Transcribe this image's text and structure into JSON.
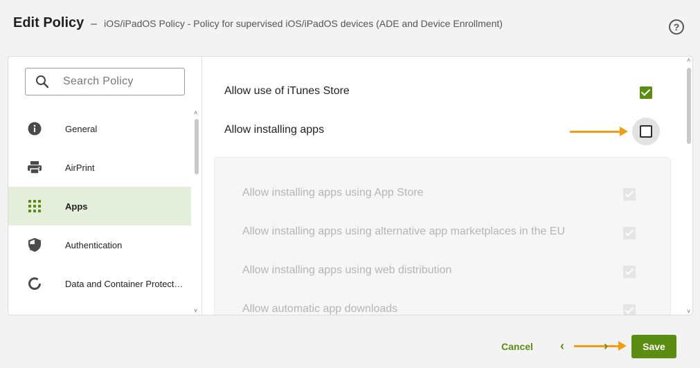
{
  "header": {
    "title": "Edit Policy",
    "separator": "–",
    "subtitle": "iOS/iPadOS Policy - Policy for supervised iOS/iPadOS devices (ADE and Device Enrollment)",
    "help_icon": "question-circle-icon",
    "help_glyph": "?"
  },
  "sidebar": {
    "search": {
      "placeholder": "Search Policy",
      "value": ""
    },
    "items": [
      {
        "label": "General",
        "icon": "info-icon",
        "active": false
      },
      {
        "label": "AirPrint",
        "icon": "printer-icon",
        "active": false
      },
      {
        "label": "Apps",
        "icon": "apps-grid-icon",
        "active": true
      },
      {
        "label": "Authentication",
        "icon": "shield-icon",
        "active": false
      },
      {
        "label": "Data and Container Protection",
        "icon": "ring-icon",
        "active": false
      }
    ]
  },
  "content": {
    "settings": [
      {
        "label": "Allow use of iTunes Store",
        "checked": true
      },
      {
        "label": "Allow installing apps",
        "checked": false
      }
    ],
    "sub_settings": [
      {
        "label": "Allow installing apps using App Store",
        "checked": true,
        "disabled": true
      },
      {
        "label": "Allow installing apps using alternative app marketplaces in the EU",
        "checked": true,
        "disabled": true
      },
      {
        "label": "Allow installing apps using web distribution",
        "checked": true,
        "disabled": true
      },
      {
        "label": "Allow automatic app downloads",
        "checked": true,
        "disabled": true
      }
    ]
  },
  "footer": {
    "cancel_label": "Cancel",
    "prev_label": "‹",
    "next_label": "›",
    "save_label": "Save"
  },
  "colors": {
    "accent": "#5a8d12",
    "active_nav_bg": "#e5eedb",
    "annotation_arrow": "#f39c12"
  }
}
